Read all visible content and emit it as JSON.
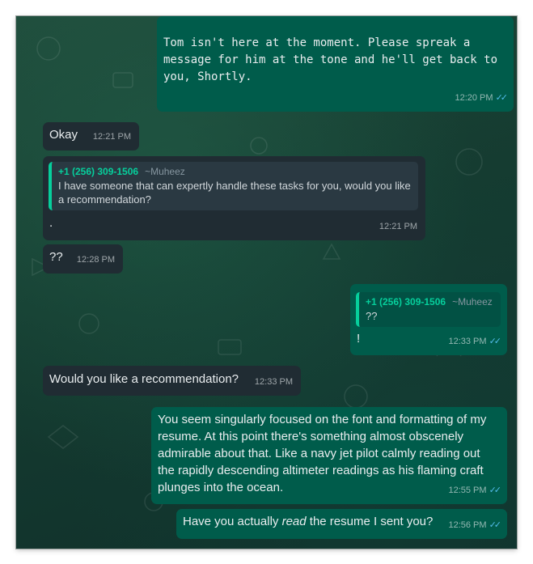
{
  "messages": [
    {
      "text": "Tom isn't here at the moment.  Please spreak a message for him at the tone and he'll get back to you, Shortly.",
      "time": "12:20 PM",
      "status": "✓✓"
    },
    {
      "text": "Okay",
      "time": "12:21 PM"
    },
    {
      "quote": {
        "phone": "+1 (256) 309-1506",
        "name": "~Muheez",
        "text": "I have someone that can expertly handle these tasks for you, would you like a recommendation?"
      },
      "text": ".",
      "time": "12:21 PM"
    },
    {
      "text": "??",
      "time": "12:28 PM"
    },
    {
      "quote": {
        "phone": "+1 (256) 309-1506",
        "name": "~Muheez",
        "text": "??"
      },
      "text": "!",
      "time": "12:33 PM",
      "status": "✓✓"
    },
    {
      "text": "Would you like a recommendation?",
      "time": "12:33 PM"
    },
    {
      "text": "You seem singularly focused on the font and formatting of my resume.  At this point there's something almost obscenely admirable about that.  Like a navy jet pilot calmly reading out the rapidly descending altimeter readings as his flaming craft plunges into the ocean.",
      "time": "12:55 PM",
      "status": "✓✓"
    },
    {
      "text_before": "Have you actually ",
      "text_em": "read",
      "text_after": " the resume I sent you?",
      "time": "12:56 PM",
      "status": "✓✓"
    }
  ]
}
